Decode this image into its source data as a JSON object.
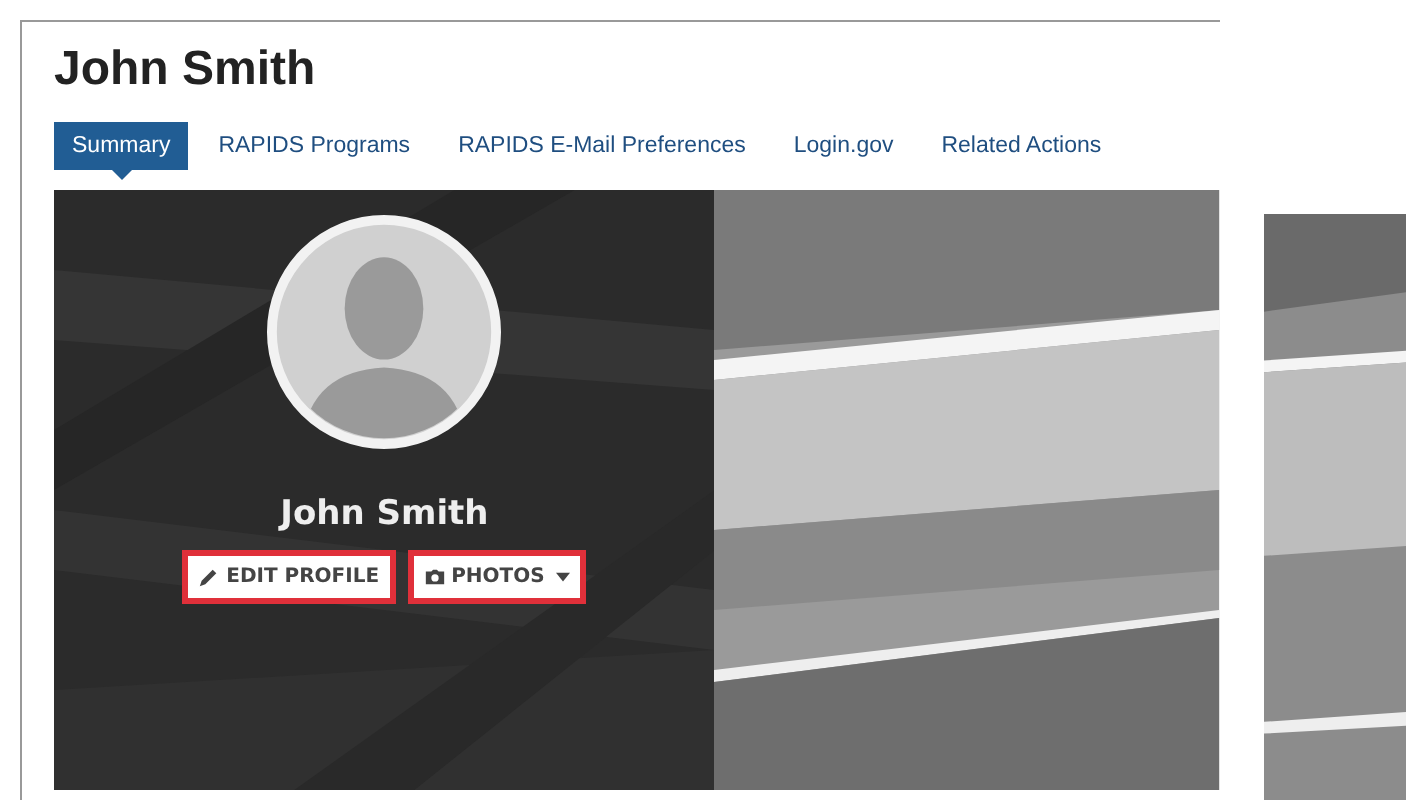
{
  "page": {
    "title": "John Smith"
  },
  "tabs": [
    {
      "label": "Summary",
      "selected": true
    },
    {
      "label": "RAPIDS Programs",
      "selected": false
    },
    {
      "label": "RAPIDS E-Mail Preferences",
      "selected": false
    },
    {
      "label": "Login.gov",
      "selected": false
    },
    {
      "label": "Related Actions",
      "selected": false
    }
  ],
  "profile": {
    "name": "John Smith",
    "buttons": [
      {
        "kind": "edit",
        "label": "EDIT PROFILE",
        "highlighted": true
      },
      {
        "kind": "photos",
        "label": "PHOTOS",
        "highlighted": true
      }
    ]
  }
}
